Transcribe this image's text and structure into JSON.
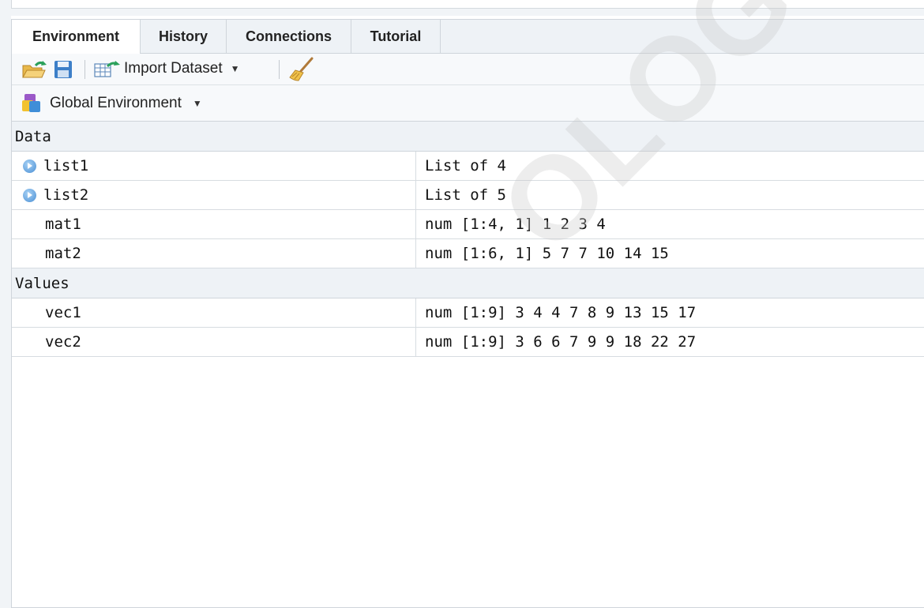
{
  "tabs": [
    {
      "label": "Environment",
      "active": true
    },
    {
      "label": "History",
      "active": false
    },
    {
      "label": "Connections",
      "active": false
    },
    {
      "label": "Tutorial",
      "active": false
    }
  ],
  "toolbar": {
    "open_icon": "open-folder-icon",
    "save_icon": "save-disk-icon",
    "import_label": "Import Dataset",
    "clear_icon": "broom-icon"
  },
  "env_selector": {
    "label": "Global Environment"
  },
  "sections": {
    "data": {
      "title": "Data",
      "rows": [
        {
          "name": "list1",
          "value": "List of 4",
          "expandable": true
        },
        {
          "name": "list2",
          "value": "List of 5",
          "expandable": true
        },
        {
          "name": "mat1",
          "value": "num [1:4, 1] 1 2 3 4",
          "expandable": false
        },
        {
          "name": "mat2",
          "value": "num [1:6, 1] 5 7 7 10 14 15",
          "expandable": false
        }
      ]
    },
    "values": {
      "title": "Values",
      "rows": [
        {
          "name": "vec1",
          "value": "num [1:9] 3 4 4 7 8 9 13 15 17"
        },
        {
          "name": "vec2",
          "value": "num [1:9] 3 6 6 7 9 9 18 22 27"
        }
      ]
    }
  },
  "watermark": "OLOGY.COM",
  "colors": {
    "expand_accent": "#4a8fd4",
    "tabbar_bg": "#eef2f6"
  }
}
